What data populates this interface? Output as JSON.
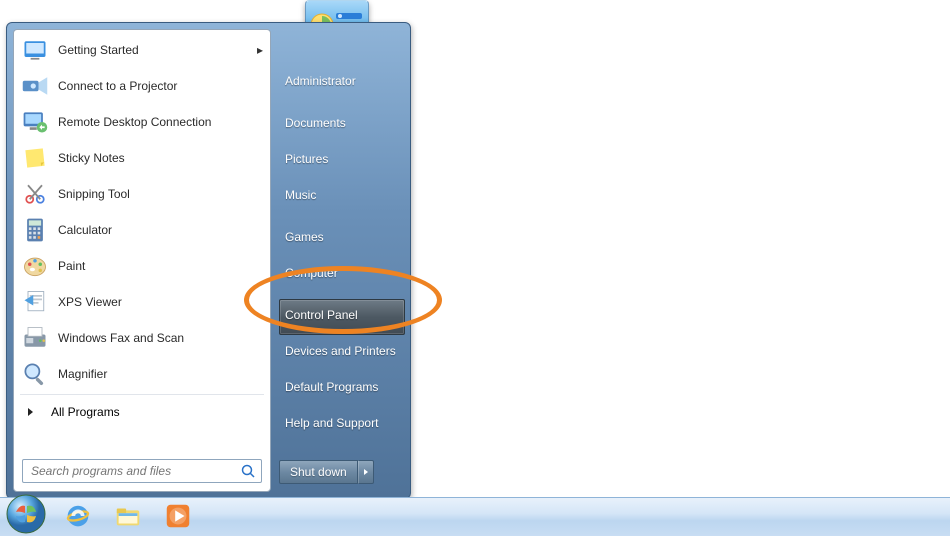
{
  "left": {
    "items": [
      {
        "label": "Getting Started",
        "submenu": true
      },
      {
        "label": "Connect to a Projector"
      },
      {
        "label": "Remote Desktop Connection"
      },
      {
        "label": "Sticky Notes"
      },
      {
        "label": "Snipping Tool"
      },
      {
        "label": "Calculator"
      },
      {
        "label": "Paint"
      },
      {
        "label": "XPS Viewer"
      },
      {
        "label": "Windows Fax and Scan"
      },
      {
        "label": "Magnifier"
      }
    ],
    "all_programs": "All Programs",
    "search_placeholder": "Search programs and files"
  },
  "right": {
    "items": [
      "Administrator",
      "Documents",
      "Pictures",
      "Music",
      "Games",
      "Computer",
      "Control Panel",
      "Devices and Printers",
      "Default Programs",
      "Help and Support"
    ],
    "selected_index": 6,
    "shutdown": "Shut down"
  },
  "annotation": {
    "highlighted": "Control Panel",
    "color": "#ee8322"
  },
  "taskbar": {
    "pinned": [
      "internet-explorer",
      "windows-explorer",
      "media-player"
    ]
  }
}
